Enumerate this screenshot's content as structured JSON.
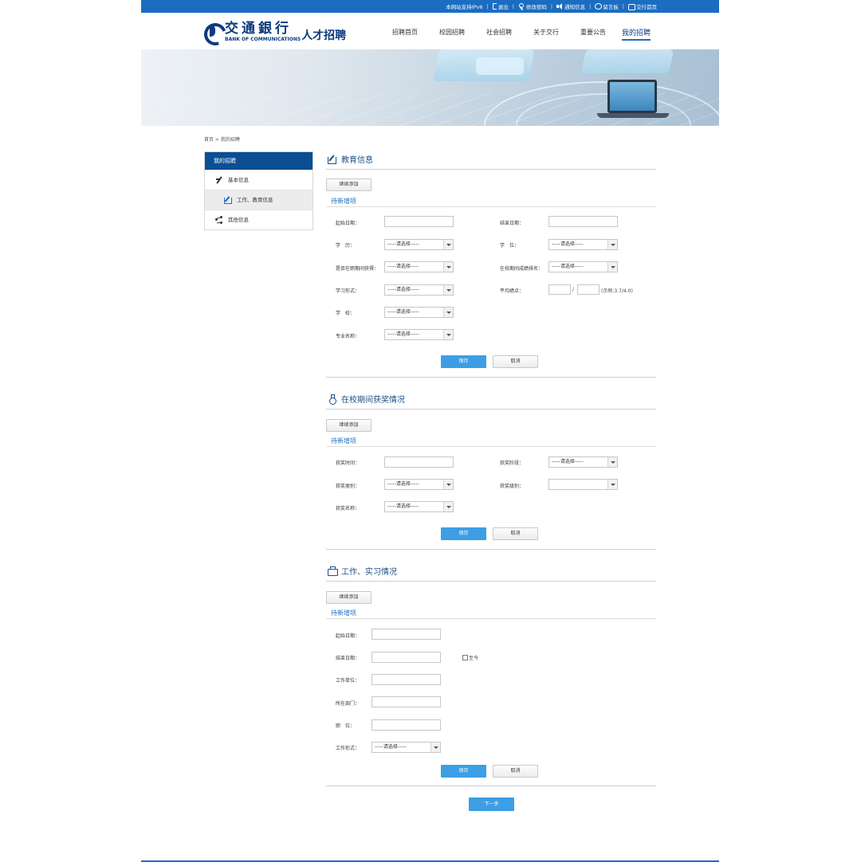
{
  "topbar": {
    "ipv6": "本网站支持IPv6",
    "logout": "退出",
    "change_password": "修改密码",
    "notices": "通知信息",
    "message_board": "留言板",
    "bank_home": "交行首页"
  },
  "header": {
    "logo_cn": "交通銀行",
    "logo_en": "BANK OF COMMUNICATIONS",
    "logo_sub": "人才招聘",
    "nav": [
      "招聘首页",
      "校园招聘",
      "社会招聘",
      "关于交行",
      "重要公告",
      "我的招聘"
    ]
  },
  "breadcrumb": "首页 > 我的招聘",
  "sidebar": {
    "title": "我的招聘",
    "items": [
      {
        "label": "基本信息",
        "icon": "pen-icon"
      },
      {
        "label": "工作、教育信息",
        "icon": "edit-icon"
      },
      {
        "label": "其他信息",
        "icon": "share-icon"
      }
    ]
  },
  "education": {
    "title": "教育信息",
    "add_btn": "继续添加",
    "pending": "待新增项",
    "start_date": "起始日期：",
    "end_date": "结束日期：",
    "education": "学　历：",
    "degree": "学　位：",
    "abroad": "是否在职期间获得：",
    "rank": "在校期间成绩排名：",
    "study_form": "学习形式：",
    "gpa": "平均绩点：",
    "gpa_sep": "/",
    "gpa_hint": "(示例:3.7/4.0)",
    "school": "学　校：",
    "major": "专业名称：",
    "select_placeholder": "-----请选择-----",
    "save": "保存",
    "cancel": "取消"
  },
  "awards": {
    "title": "在校期间获奖情况",
    "add_btn": "继续添加",
    "pending": "待新增项",
    "award_time": "获奖时间：",
    "award_stage": "获奖阶段：",
    "award_type": "获奖类别：",
    "award_level": "获奖级别：",
    "award_name": "获奖名称：",
    "select_placeholder": "-----请选择-----",
    "save": "保存",
    "cancel": "取消"
  },
  "work": {
    "title": "工作、实习情况",
    "add_btn": "继续添加",
    "pending": "待新增项",
    "start_date": "起始日期：",
    "end_date": "结束日期：",
    "until_now": "至今",
    "employer": "工作单位：",
    "department": "所在部门：",
    "position": "职　位：",
    "work_form": "工作形式：",
    "select_placeholder": "-----请选择-----",
    "save": "保存",
    "cancel": "取消"
  },
  "next_btn": "下一步",
  "colors": {
    "topbar": "#1b6dc1",
    "brand": "#0b3a7e",
    "primary_button": "#3d9ee5"
  }
}
